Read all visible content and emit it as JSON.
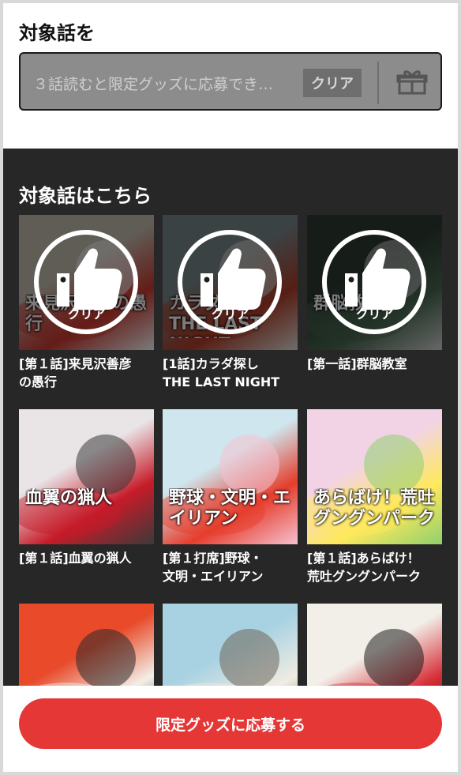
{
  "top": {
    "title": "対象話を",
    "status_text": "３話読むと限定グッズに応募でき…",
    "clear_label": "クリア",
    "gift_icon": "gift-icon"
  },
  "episodes": {
    "title": "対象話はこちら",
    "items": [
      {
        "title": "[第１話]来見沢善彦",
        "title2": "の愚行",
        "cleared": true,
        "badge": "クリア",
        "cover_title": "来見沢善彦の愚行",
        "colors": [
          "#c9c2b6",
          "#d23b32",
          "#ffffff"
        ]
      },
      {
        "title": "[1話]カラダ探し",
        "title2": "THE LAST NIGHT",
        "cleared": true,
        "badge": "クリア",
        "cover_title": "カラダ探し THE LAST NIGHT",
        "colors": [
          "#7c8a8e",
          "#b53f2a",
          "#e8e3dc"
        ]
      },
      {
        "title": "[第一話]群脳教室",
        "title2": "",
        "cleared": true,
        "badge": "クリア",
        "cover_title": "群脳教室",
        "colors": [
          "#2e3b34",
          "#4a6b52",
          "#d7d7d7"
        ]
      },
      {
        "title": "[第１話]血翼の猟人",
        "title2": "",
        "cleared": false,
        "badge": "",
        "cover_title": "血翼の猟人",
        "colors": [
          "#e9e4e6",
          "#c61b29",
          "#3a3a3a"
        ]
      },
      {
        "title": "[第１打席]野球・",
        "title2": "文明・エイリアン",
        "cleared": false,
        "badge": "",
        "cover_title": "野球・文明・エイリアン",
        "colors": [
          "#cfe6ee",
          "#e63d2c",
          "#f5c1d0"
        ]
      },
      {
        "title": "[第１話]あらばけ！",
        "title2": "荒吐グングンパーク",
        "cleared": false,
        "badge": "",
        "cover_title": "あらばけ！荒吐グングンパーク",
        "colors": [
          "#f2d3e6",
          "#ffe95c",
          "#8fd06d"
        ]
      },
      {
        "title": "",
        "title2": "",
        "cleared": false,
        "badge": "",
        "cover_title": "",
        "colors": [
          "#e84a2a",
          "#f3efe8",
          "#2a2a2a"
        ]
      },
      {
        "title": "",
        "title2": "",
        "cleared": false,
        "badge": "",
        "cover_title": "",
        "colors": [
          "#a8d2e2",
          "#f0ece2",
          "#6d6457"
        ]
      },
      {
        "title": "",
        "title2": "",
        "cleared": false,
        "badge": "",
        "cover_title": "",
        "colors": [
          "#f2efe9",
          "#d62d35",
          "#1e1e1e"
        ]
      }
    ]
  },
  "cta": {
    "label": "限定グッズに応募する"
  }
}
